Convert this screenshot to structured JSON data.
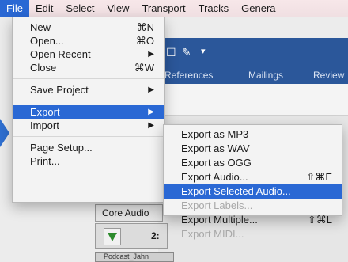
{
  "menubar": {
    "items": [
      "File",
      "Edit",
      "Select",
      "View",
      "Transport",
      "Tracks",
      "Genera"
    ]
  },
  "background_app": {
    "tabs": [
      "References",
      "Mailings",
      "Review"
    ]
  },
  "file_menu": {
    "items": [
      {
        "label": "New",
        "shortcut": "⌘N"
      },
      {
        "label": "Open...",
        "shortcut": "⌘O"
      },
      {
        "label": "Open Recent",
        "submenu": "▶"
      },
      {
        "label": "Close",
        "shortcut": "⌘W"
      },
      {
        "label": "Save Project",
        "submenu": "▶"
      },
      {
        "label": "Export",
        "submenu": "▶"
      },
      {
        "label": "Import",
        "submenu": "▶"
      },
      {
        "label": "Page Setup..."
      },
      {
        "label": "Print..."
      }
    ]
  },
  "export_menu": {
    "items": [
      {
        "label": "Export as MP3"
      },
      {
        "label": "Export as WAV"
      },
      {
        "label": "Export as OGG"
      },
      {
        "label": "Export Audio...",
        "shortcut": "⇧⌘E"
      },
      {
        "label": "Export Selected Audio..."
      },
      {
        "label": "Export Labels..."
      },
      {
        "label": "Export Multiple...",
        "shortcut": "⇧⌘L"
      },
      {
        "label": "Export MIDI..."
      }
    ]
  },
  "audacity": {
    "device_label": "Core Audio",
    "time_display": "2:",
    "track_name": "Podcast_Jahn"
  },
  "colors": {
    "highlight": "#2a68d4",
    "menubar_bg": "#f3e4e6",
    "word_blue": "#2b579a"
  }
}
